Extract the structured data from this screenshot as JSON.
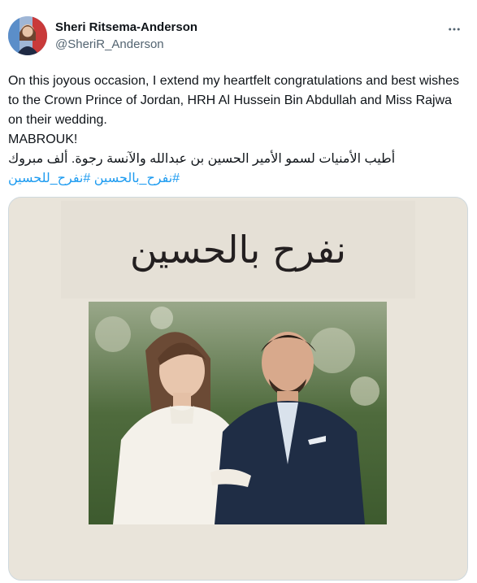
{
  "user": {
    "display_name": "Sheri Ritsema-Anderson",
    "handle": "@SheriR_Anderson",
    "avatar_icon": "profile-photo"
  },
  "more_icon": "more-horizontal-icon",
  "tweet": {
    "line1": "On this joyous occasion, I extend my heartfelt congratulations and best wishes to the Crown Prince of Jordan, HRH Al Hussein Bin Abdullah and Miss Rajwa on their wedding.",
    "line2": "MABROUK!",
    "arabic": "أطيب الأمنيات لسمو الأمير الحسين بن عبدالله والآنسة رجوة. ألف مبروك",
    "hashtag1": "#نفرح_للحسين",
    "hashtag2": "#نفرح_بالحسين"
  },
  "media": {
    "calligraphy": "نفرح بالحسين"
  },
  "colors": {
    "link": "#1d9bf0",
    "secondary_text": "#536471",
    "card_background": "#e9e4da"
  }
}
